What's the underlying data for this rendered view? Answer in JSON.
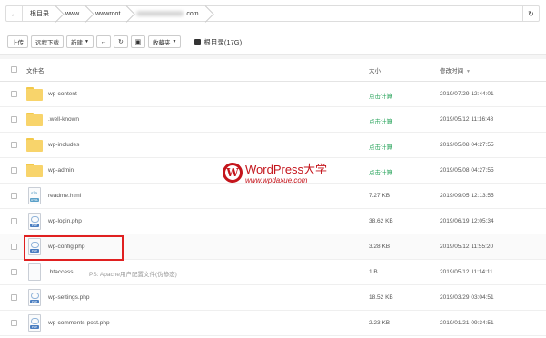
{
  "breadcrumb": {
    "back_icon": "arrow-left-icon",
    "items": [
      "根目录",
      "www",
      "wwwroot",
      ".com"
    ],
    "refresh_icon": "refresh-icon"
  },
  "toolbar": {
    "upload": "上传",
    "remote_download": "远程下载",
    "new": "新建",
    "favorites": "收藏夹",
    "disk_label": "根目录(17G)"
  },
  "table": {
    "col_name": "文件名",
    "col_size": "大小",
    "col_time": "修改时间",
    "rows": [
      {
        "name": "wp-content",
        "type": "folder",
        "size": "点击计算",
        "time": "2019/07/29 12:44:01"
      },
      {
        "name": ".well-known",
        "type": "folder",
        "size": "点击计算",
        "time": "2019/05/12 11:16:48"
      },
      {
        "name": "wp-includes",
        "type": "folder",
        "size": "点击计算",
        "time": "2019/05/08 04:27:55"
      },
      {
        "name": "wp-admin",
        "type": "folder",
        "size": "点击计算",
        "time": "2019/05/08 04:27:55"
      },
      {
        "name": "readme.html",
        "type": "html",
        "size": "7.27 KB",
        "time": "2019/09/05 12:13:55"
      },
      {
        "name": "wp-login.php",
        "type": "php",
        "size": "38.62 KB",
        "time": "2019/06/19 12:05:34"
      },
      {
        "name": "wp-config.php",
        "type": "php",
        "size": "3.28 KB",
        "time": "2019/05/12 11:55:20"
      },
      {
        "name": ".htaccess",
        "type": "plain",
        "note": "PS: Apache用户配置文件(伪静态)",
        "size": "1 B",
        "time": "2019/05/12 11:14:11"
      },
      {
        "name": "wp-settings.php",
        "type": "php",
        "size": "18.52 KB",
        "time": "2019/03/29 03:04:51"
      },
      {
        "name": "wp-comments-post.php",
        "type": "php",
        "size": "2.23 KB",
        "time": "2019/01/21 09:34:51"
      }
    ]
  },
  "watermark": {
    "title": "WordPress大学",
    "subtitle": "www.wpdaxue.com",
    "logo_letter": "W"
  },
  "colors": {
    "calc_green": "#27a35a",
    "highlight_red": "#e02020",
    "brand_red": "#c4151c"
  }
}
